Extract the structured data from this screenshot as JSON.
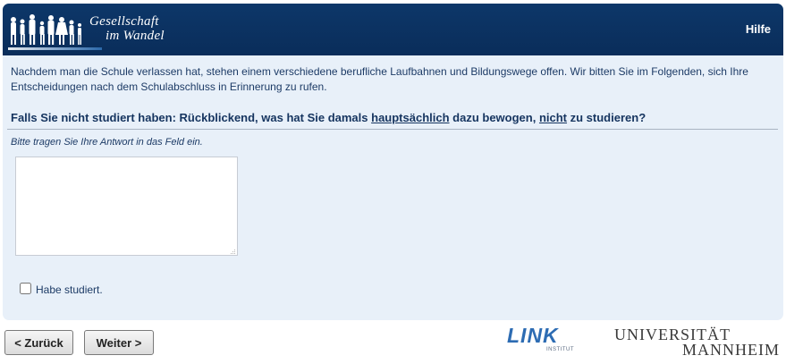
{
  "header": {
    "logo_line1": "Gesellschaft",
    "logo_line2": "im Wandel",
    "help_label": "Hilfe"
  },
  "intro": "Nachdem man die Schule verlassen hat, stehen einem verschiedene berufliche Laufbahnen und Bildungswege offen. Wir bitten Sie im Folgenden, sich Ihre Entscheidungen nach dem Schulabschluss in Erinnerung zu rufen.",
  "question": {
    "part1": "Falls Sie nicht studiert haben: Rückblickend, was hat Sie damals ",
    "emph1": "hauptsächlich",
    "part2": " dazu bewogen, ",
    "emph2": "nicht",
    "part3": " zu studieren?"
  },
  "hint": "Bitte tragen Sie Ihre Antwort in das Feld ein.",
  "answer_value": "",
  "checkbox": {
    "label": "Habe studiert.",
    "checked": false
  },
  "nav": {
    "back_label": "< Zurück",
    "next_label": "Weiter >"
  },
  "footer": {
    "link_logo": "LINK",
    "link_sub": "INSTITUT",
    "uni_line1": "UNIVERSITÄT",
    "uni_line2": "MANNHEIM"
  },
  "colors": {
    "header": "#0d3769",
    "panel": "#e8f0f9",
    "text": "#1d3b66",
    "link_blue": "#2d6cb3"
  }
}
